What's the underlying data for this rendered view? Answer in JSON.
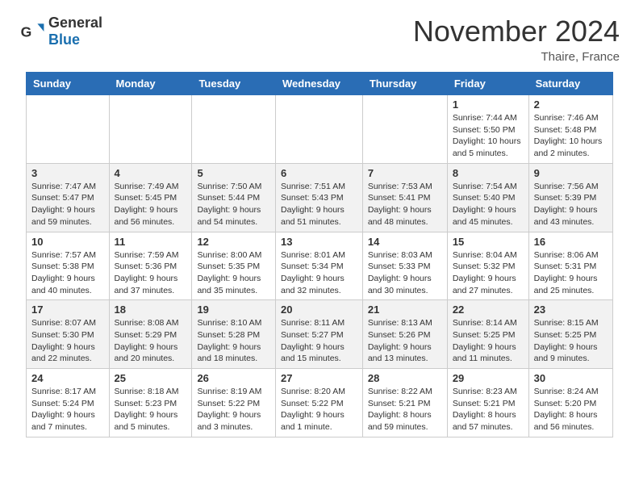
{
  "header": {
    "logo_general": "General",
    "logo_blue": "Blue",
    "month_title": "November 2024",
    "location": "Thaire, France"
  },
  "calendar": {
    "days_of_week": [
      "Sunday",
      "Monday",
      "Tuesday",
      "Wednesday",
      "Thursday",
      "Friday",
      "Saturday"
    ],
    "weeks": [
      [
        {
          "day": "",
          "info": ""
        },
        {
          "day": "",
          "info": ""
        },
        {
          "day": "",
          "info": ""
        },
        {
          "day": "",
          "info": ""
        },
        {
          "day": "",
          "info": ""
        },
        {
          "day": "1",
          "info": "Sunrise: 7:44 AM\nSunset: 5:50 PM\nDaylight: 10 hours and 5 minutes."
        },
        {
          "day": "2",
          "info": "Sunrise: 7:46 AM\nSunset: 5:48 PM\nDaylight: 10 hours and 2 minutes."
        }
      ],
      [
        {
          "day": "3",
          "info": "Sunrise: 7:47 AM\nSunset: 5:47 PM\nDaylight: 9 hours and 59 minutes."
        },
        {
          "day": "4",
          "info": "Sunrise: 7:49 AM\nSunset: 5:45 PM\nDaylight: 9 hours and 56 minutes."
        },
        {
          "day": "5",
          "info": "Sunrise: 7:50 AM\nSunset: 5:44 PM\nDaylight: 9 hours and 54 minutes."
        },
        {
          "day": "6",
          "info": "Sunrise: 7:51 AM\nSunset: 5:43 PM\nDaylight: 9 hours and 51 minutes."
        },
        {
          "day": "7",
          "info": "Sunrise: 7:53 AM\nSunset: 5:41 PM\nDaylight: 9 hours and 48 minutes."
        },
        {
          "day": "8",
          "info": "Sunrise: 7:54 AM\nSunset: 5:40 PM\nDaylight: 9 hours and 45 minutes."
        },
        {
          "day": "9",
          "info": "Sunrise: 7:56 AM\nSunset: 5:39 PM\nDaylight: 9 hours and 43 minutes."
        }
      ],
      [
        {
          "day": "10",
          "info": "Sunrise: 7:57 AM\nSunset: 5:38 PM\nDaylight: 9 hours and 40 minutes."
        },
        {
          "day": "11",
          "info": "Sunrise: 7:59 AM\nSunset: 5:36 PM\nDaylight: 9 hours and 37 minutes."
        },
        {
          "day": "12",
          "info": "Sunrise: 8:00 AM\nSunset: 5:35 PM\nDaylight: 9 hours and 35 minutes."
        },
        {
          "day": "13",
          "info": "Sunrise: 8:01 AM\nSunset: 5:34 PM\nDaylight: 9 hours and 32 minutes."
        },
        {
          "day": "14",
          "info": "Sunrise: 8:03 AM\nSunset: 5:33 PM\nDaylight: 9 hours and 30 minutes."
        },
        {
          "day": "15",
          "info": "Sunrise: 8:04 AM\nSunset: 5:32 PM\nDaylight: 9 hours and 27 minutes."
        },
        {
          "day": "16",
          "info": "Sunrise: 8:06 AM\nSunset: 5:31 PM\nDaylight: 9 hours and 25 minutes."
        }
      ],
      [
        {
          "day": "17",
          "info": "Sunrise: 8:07 AM\nSunset: 5:30 PM\nDaylight: 9 hours and 22 minutes."
        },
        {
          "day": "18",
          "info": "Sunrise: 8:08 AM\nSunset: 5:29 PM\nDaylight: 9 hours and 20 minutes."
        },
        {
          "day": "19",
          "info": "Sunrise: 8:10 AM\nSunset: 5:28 PM\nDaylight: 9 hours and 18 minutes."
        },
        {
          "day": "20",
          "info": "Sunrise: 8:11 AM\nSunset: 5:27 PM\nDaylight: 9 hours and 15 minutes."
        },
        {
          "day": "21",
          "info": "Sunrise: 8:13 AM\nSunset: 5:26 PM\nDaylight: 9 hours and 13 minutes."
        },
        {
          "day": "22",
          "info": "Sunrise: 8:14 AM\nSunset: 5:25 PM\nDaylight: 9 hours and 11 minutes."
        },
        {
          "day": "23",
          "info": "Sunrise: 8:15 AM\nSunset: 5:25 PM\nDaylight: 9 hours and 9 minutes."
        }
      ],
      [
        {
          "day": "24",
          "info": "Sunrise: 8:17 AM\nSunset: 5:24 PM\nDaylight: 9 hours and 7 minutes."
        },
        {
          "day": "25",
          "info": "Sunrise: 8:18 AM\nSunset: 5:23 PM\nDaylight: 9 hours and 5 minutes."
        },
        {
          "day": "26",
          "info": "Sunrise: 8:19 AM\nSunset: 5:22 PM\nDaylight: 9 hours and 3 minutes."
        },
        {
          "day": "27",
          "info": "Sunrise: 8:20 AM\nSunset: 5:22 PM\nDaylight: 9 hours and 1 minute."
        },
        {
          "day": "28",
          "info": "Sunrise: 8:22 AM\nSunset: 5:21 PM\nDaylight: 8 hours and 59 minutes."
        },
        {
          "day": "29",
          "info": "Sunrise: 8:23 AM\nSunset: 5:21 PM\nDaylight: 8 hours and 57 minutes."
        },
        {
          "day": "30",
          "info": "Sunrise: 8:24 AM\nSunset: 5:20 PM\nDaylight: 8 hours and 56 minutes."
        }
      ]
    ]
  }
}
